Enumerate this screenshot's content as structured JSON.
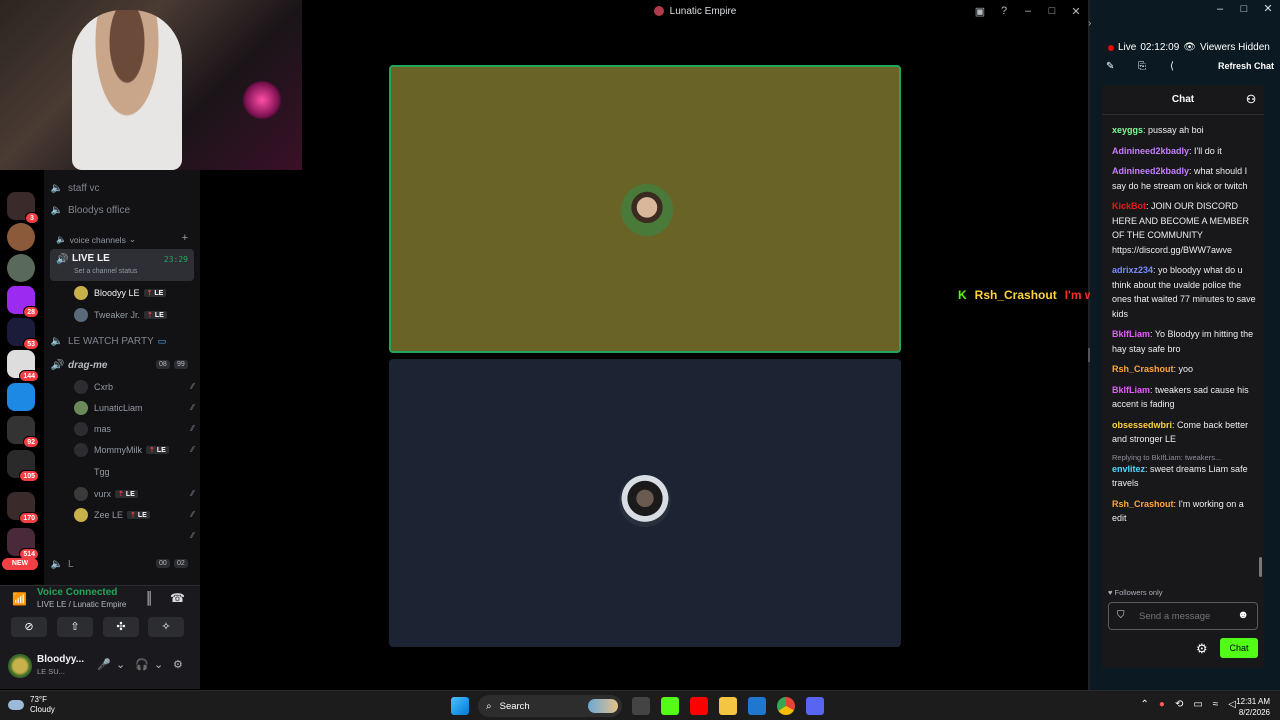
{
  "window": {
    "title": "Lunatic Empire"
  },
  "guild_badges": [
    "3",
    "28",
    "53",
    "144",
    "92",
    "105",
    "170",
    "514"
  ],
  "guild_new_label": "NEW",
  "server_logo": "LC",
  "channels": {
    "staff_vc": "staff vc",
    "bloodys_office": "Bloodys office",
    "voice_category": "voice channels",
    "live_channel": {
      "name": "LIVE LE",
      "timer": "23:29",
      "status_placeholder": "Set a channel status"
    },
    "live_members": [
      {
        "name": "Bloodyy LE",
        "tag": "LE"
      },
      {
        "name": "Tweaker Jr.",
        "tag": "LE"
      }
    ],
    "watch_party": "LE WATCH PARTY",
    "drag_me": {
      "name": "drag-me",
      "count_a": "08",
      "count_b": "99"
    },
    "drag_members": [
      {
        "name": "Cxrb",
        "tag": ""
      },
      {
        "name": "LunaticLiam",
        "tag": ""
      },
      {
        "name": "mas",
        "tag": ""
      },
      {
        "name": "MommyMilk",
        "tag": "LE"
      },
      {
        "name": "Tgg",
        "tag": ""
      },
      {
        "name": "vurx",
        "tag": "LE"
      },
      {
        "name": "Zee LE",
        "tag": "LE"
      },
      {
        "name": "",
        "tag": ""
      }
    ],
    "l_channel": {
      "name": "L",
      "count_a": "00",
      "count_b": "02"
    }
  },
  "voice_panel": {
    "title": "Voice Connected",
    "subtitle": "LIVE LE / Lunatic Empire"
  },
  "user_panel": {
    "name": "Bloodyy...",
    "status": "LE SU..."
  },
  "floating_message": {
    "user": "Rsh_Crashout",
    "text": "I'm working on a edit"
  },
  "stream_panel": {
    "live_label": "Live",
    "live_time": "02:12:09",
    "viewers": "Viewers Hidden",
    "refresh": "Refresh Chat",
    "chat_title": "Chat",
    "followers_only": "Followers only",
    "send_placeholder": "Send a message",
    "send_button": "Chat"
  },
  "chat_messages": [
    {
      "user": "xeyggs",
      "color": "#7cfc9a",
      "text": "pussay ah boi",
      "reply": ""
    },
    {
      "user": "Adinineed2kbadly",
      "color": "#c77dff",
      "text": "I'll do it",
      "reply": ""
    },
    {
      "user": "Adinineed2kbadly",
      "color": "#c77dff",
      "text": "what should I say do he stream on kick or twitch",
      "reply": ""
    },
    {
      "user": "KickBot",
      "color": "#e91916",
      "text": "JOIN OUR DISCORD HERE AND BECOME A MEMBER OF THE COMMUNITY https://discord.gg/BWW7awve",
      "reply": ""
    },
    {
      "user": "adrixz234",
      "color": "#7b8cff",
      "text": "yo bloodyy what do u think about the uvalde police the ones that waited 77 minutes to save kids",
      "reply": ""
    },
    {
      "user": "BklfLiam",
      "color": "#e75bff",
      "text": "Yo Bloodyy im hitting the hay stay safe bro",
      "reply": ""
    },
    {
      "user": "Rsh_Crashout",
      "color": "#ffa63e",
      "text": "yoo",
      "reply": ""
    },
    {
      "user": "BklfLiam",
      "color": "#e75bff",
      "text": "tweakers sad cause his accent is fading",
      "reply": ""
    },
    {
      "user": "obsessedwbri",
      "color": "#ffd23e",
      "text": "Come back better and stronger LE",
      "reply": ""
    },
    {
      "user": "envlitez",
      "color": "#4dd9ff",
      "text": "sweet dreams Liam safe travels",
      "reply": "Replying to BkIfLiam: tweakers..."
    },
    {
      "user": "Rsh_Crashout",
      "color": "#ffa63e",
      "text": "I'm working on a edit",
      "reply": ""
    }
  ],
  "taskbar": {
    "temp": "73°F",
    "weather": "Cloudy",
    "search": "Search",
    "time": "12:31 AM",
    "date": "8/2/2026"
  }
}
